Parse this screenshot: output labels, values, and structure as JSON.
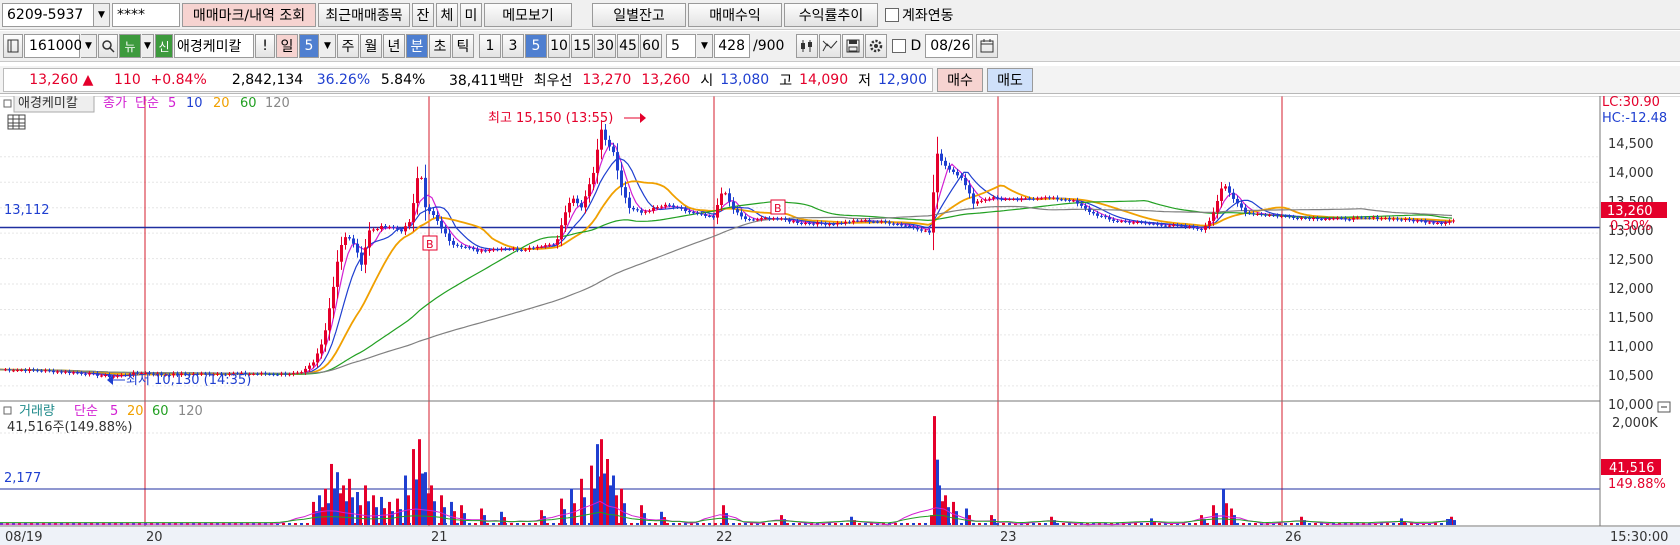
{
  "toolbar1": {
    "account": "6209-5937",
    "password": "****",
    "trade_mark_btn": "매매마크/내역 조회",
    "recent_btn": "최근매매종목",
    "btn_jan": "잔",
    "btn_che": "체",
    "btn_mi": "미",
    "memo_btn": "메모보기",
    "daily_balance_btn": "일별잔고",
    "trade_profit_btn": "매매수익",
    "profit_trend_btn": "수익률추이",
    "account_link_label": "계좌연동"
  },
  "toolbar2": {
    "code": "161000",
    "news_icon_label": "뉴",
    "credit_label": "신",
    "stock_name": "애경케미칼",
    "alert_label": "!",
    "period_day": "일",
    "period_day_value": "5",
    "period_week": "주",
    "period_month": "월",
    "period_year": "년",
    "period_min": "분",
    "period_sec": "초",
    "period_tick": "틱",
    "intervals": [
      "1",
      "3",
      "5",
      "10",
      "15",
      "30",
      "45",
      "60"
    ],
    "selected_interval": "5",
    "count_select": "5",
    "count_value": "428",
    "count_max": "/900",
    "d_label": "D",
    "date_value": "08/26"
  },
  "quote": {
    "price": "13,260",
    "change": "110",
    "change_pct": "+0.84%",
    "volume": "2,842,134",
    "volume_ratio": "36.26%",
    "turnover": "5.84%",
    "amount": "38,411백만",
    "best_label": "최우선",
    "ask": "13,270",
    "bid": "13,260",
    "open_label": "시",
    "open": "13,080",
    "high_label": "고",
    "high": "14,090",
    "low_label": "저",
    "low": "12,900",
    "buy_btn": "매수",
    "sell_btn": "매도"
  },
  "price_panel": {
    "stock": "애경케미칼",
    "price_label": "종가",
    "ma_type": "단순",
    "ma_periods": [
      "5",
      "10",
      "20",
      "60",
      "120"
    ],
    "ref_price_label": "13,112",
    "high_annotation": "최고 15,150 (13:55)",
    "low_annotation": "최저 10,130 (14:35)",
    "lc_label": "LC:30.90",
    "hc_label": "HC:-12.48",
    "current_tag": "13,260",
    "pct_tag": "0.30%",
    "y_ticks": [
      "14,500",
      "14,000",
      "13,500",
      "13,000",
      "12,500",
      "12,000",
      "11,500",
      "11,000",
      "10,500",
      "10,000"
    ],
    "marker_label": "B"
  },
  "volume_panel": {
    "title": "거래량",
    "ma_type": "단순",
    "ma_periods": [
      "5",
      "20",
      "60",
      "120"
    ],
    "current_text": "41,516주(149.88%)",
    "ref_label": "2,177",
    "y_tick": "2,000K",
    "current_tag": "41,516",
    "pct_tag": "149.88%"
  },
  "x_axis": {
    "labels": [
      "08/19",
      "20",
      "21",
      "22",
      "23",
      "26"
    ],
    "time": "15:30:00"
  },
  "colors": {
    "up": "#e4002b",
    "down": "#1f3fd0",
    "ma5": "#d21fd2",
    "ma10": "#1f3fd0",
    "ma20": "#f0a000",
    "ma60": "#22a022",
    "ma120": "#808080"
  },
  "chart_data": {
    "type": "candlestick",
    "interval_minutes": 5,
    "days": [
      "08/19",
      "20",
      "21",
      "22",
      "23",
      "26"
    ],
    "ylim": [
      9800,
      15400
    ],
    "reference_price": 13112,
    "current_price": 13260,
    "session_high": {
      "price": 15150,
      "time": "13:55",
      "day": "21"
    },
    "session_low": {
      "price": 10130,
      "time": "14:35",
      "day": "08/19"
    },
    "price_path": [
      [
        0,
        10320
      ],
      [
        40,
        10300
      ],
      [
        80,
        10250
      ],
      [
        110,
        10180
      ],
      [
        140,
        10260
      ],
      [
        160,
        10220
      ],
      [
        220,
        10240
      ],
      [
        280,
        10230
      ],
      [
        300,
        10250
      ],
      [
        312,
        10450
      ],
      [
        322,
        10900
      ],
      [
        332,
        11950
      ],
      [
        338,
        12700
      ],
      [
        345,
        12950
      ],
      [
        352,
        12800
      ],
      [
        360,
        12400
      ],
      [
        368,
        13050
      ],
      [
        380,
        13120
      ],
      [
        392,
        13100
      ],
      [
        400,
        13050
      ],
      [
        408,
        13200
      ],
      [
        414,
        13800
      ],
      [
        418,
        14400
      ],
      [
        424,
        13500
      ],
      [
        432,
        13350
      ],
      [
        440,
        13100
      ],
      [
        450,
        12800
      ],
      [
        460,
        12750
      ],
      [
        475,
        12650
      ],
      [
        500,
        12700
      ],
      [
        520,
        12680
      ],
      [
        540,
        12750
      ],
      [
        555,
        12800
      ],
      [
        562,
        13300
      ],
      [
        570,
        13700
      ],
      [
        580,
        13500
      ],
      [
        592,
        14200
      ],
      [
        600,
        15050
      ],
      [
        605,
        14800
      ],
      [
        612,
        14600
      ],
      [
        620,
        13900
      ],
      [
        628,
        13500
      ],
      [
        640,
        13400
      ],
      [
        655,
        13500
      ],
      [
        666,
        13550
      ],
      [
        690,
        13400
      ],
      [
        712,
        13300
      ],
      [
        722,
        13900
      ],
      [
        730,
        13500
      ],
      [
        745,
        13250
      ],
      [
        770,
        13300
      ],
      [
        800,
        13200
      ],
      [
        830,
        13180
      ],
      [
        860,
        13250
      ],
      [
        890,
        13200
      ],
      [
        915,
        13100
      ],
      [
        930,
        13000
      ],
      [
        934,
        14600
      ],
      [
        945,
        14300
      ],
      [
        960,
        14100
      ],
      [
        972,
        13600
      ],
      [
        990,
        13700
      ],
      [
        1010,
        13650
      ],
      [
        1040,
        13700
      ],
      [
        1070,
        13650
      ],
      [
        1090,
        13400
      ],
      [
        1110,
        13250
      ],
      [
        1140,
        13200
      ],
      [
        1170,
        13150
      ],
      [
        1196,
        13100
      ],
      [
        1200,
        13050
      ],
      [
        1210,
        13300
      ],
      [
        1222,
        14000
      ],
      [
        1230,
        13700
      ],
      [
        1245,
        13400
      ],
      [
        1270,
        13350
      ],
      [
        1300,
        13300
      ],
      [
        1340,
        13280
      ],
      [
        1380,
        13300
      ],
      [
        1410,
        13250
      ],
      [
        1440,
        13200
      ],
      [
        1455,
        13260
      ]
    ],
    "volume_bars": [
      [
        312,
        70
      ],
      [
        318,
        90
      ],
      [
        324,
        110
      ],
      [
        330,
        185
      ],
      [
        336,
        160
      ],
      [
        342,
        120
      ],
      [
        348,
        140
      ],
      [
        356,
        100
      ],
      [
        364,
        120
      ],
      [
        372,
        90
      ],
      [
        380,
        85
      ],
      [
        388,
        70
      ],
      [
        396,
        80
      ],
      [
        404,
        150
      ],
      [
        412,
        230
      ],
      [
        418,
        260
      ],
      [
        424,
        160
      ],
      [
        430,
        120
      ],
      [
        440,
        90
      ],
      [
        450,
        70
      ],
      [
        460,
        60
      ],
      [
        480,
        50
      ],
      [
        500,
        40
      ],
      [
        540,
        45
      ],
      [
        560,
        80
      ],
      [
        570,
        110
      ],
      [
        580,
        140
      ],
      [
        590,
        180
      ],
      [
        596,
        245
      ],
      [
        600,
        260
      ],
      [
        606,
        200
      ],
      [
        612,
        150
      ],
      [
        620,
        110
      ],
      [
        640,
        60
      ],
      [
        660,
        40
      ],
      [
        722,
        60
      ],
      [
        780,
        30
      ],
      [
        850,
        25
      ],
      [
        930,
        30
      ],
      [
        933,
        330
      ],
      [
        938,
        120
      ],
      [
        944,
        90
      ],
      [
        952,
        70
      ],
      [
        965,
        50
      ],
      [
        990,
        30
      ],
      [
        1050,
        25
      ],
      [
        1150,
        20
      ],
      [
        1200,
        30
      ],
      [
        1212,
        60
      ],
      [
        1222,
        110
      ],
      [
        1230,
        50
      ],
      [
        1300,
        25
      ],
      [
        1400,
        20
      ],
      [
        1450,
        25
      ]
    ]
  }
}
